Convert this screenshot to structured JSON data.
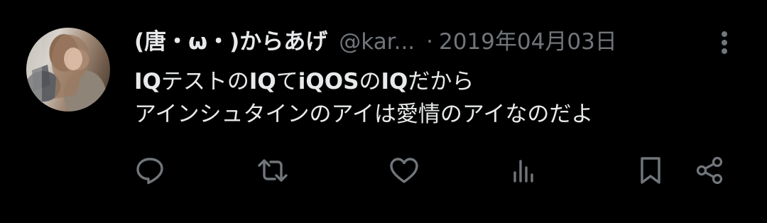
{
  "tweet": {
    "display_name": "(唐・ω・)からあげ",
    "handle": "@kar...",
    "separator": "·",
    "date": "2019年04月03日",
    "body": {
      "line1": {
        "s1": "IQ",
        "s2": "テストの",
        "s3": "IQ",
        "s4": "て",
        "s5": "iQOS",
        "s6": "の",
        "s7": "IQ",
        "s8": "だから"
      },
      "line2": "アインシュタインのアイは愛情のアイなのだよ"
    }
  },
  "icons": {
    "avatar": "user-avatar",
    "more": "more-vertical-icon",
    "reply": "reply-icon",
    "retweet": "retweet-icon",
    "like": "heart-icon",
    "views": "views-icon",
    "bookmark": "bookmark-icon",
    "share": "share-icon"
  },
  "colors": {
    "background": "#000000",
    "primary_text": "#e7e9ea",
    "secondary_text": "#71767b"
  }
}
